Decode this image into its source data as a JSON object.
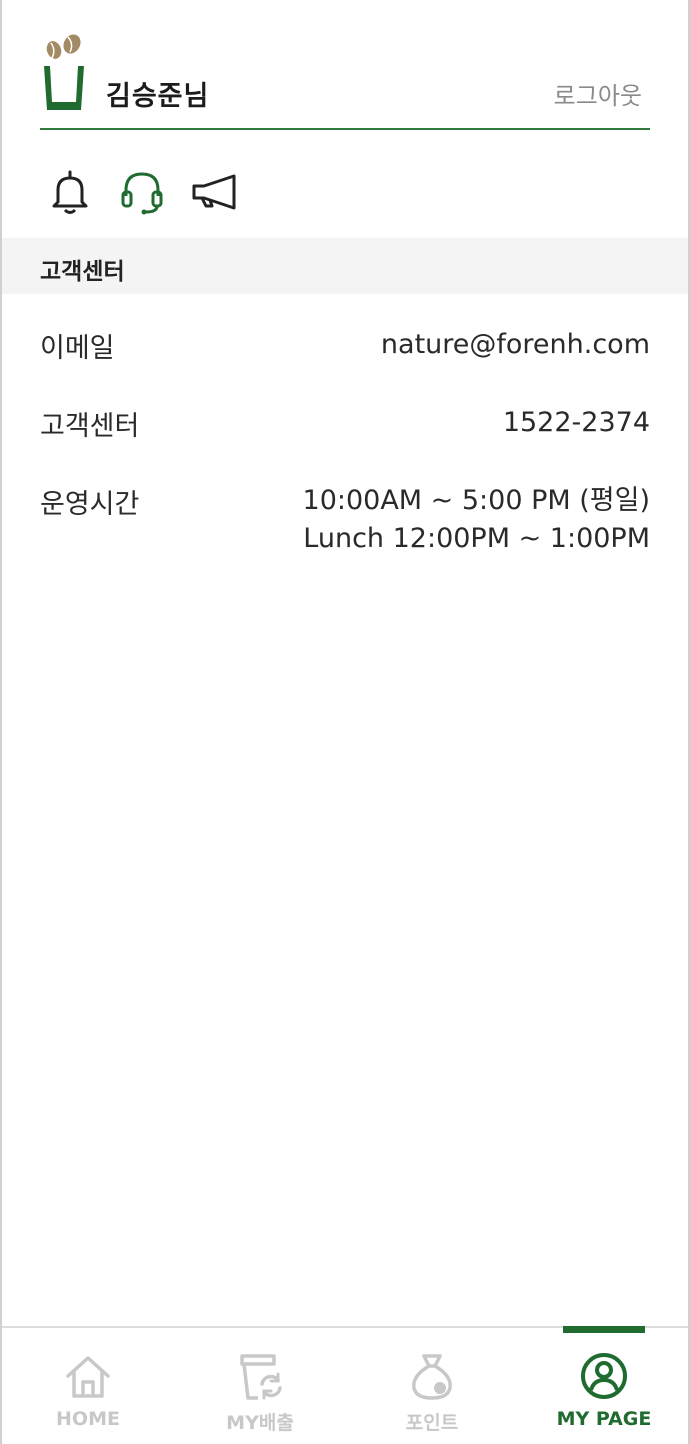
{
  "header": {
    "username": "김승준님",
    "logout_label": "로그아웃"
  },
  "icons": [
    {
      "name": "notification",
      "icon": "bell-icon"
    },
    {
      "name": "customer-center",
      "icon": "headset-icon",
      "active": true
    },
    {
      "name": "notice",
      "icon": "megaphone-icon"
    }
  ],
  "section": {
    "title": "고객센터"
  },
  "info": {
    "email_label": "이메일",
    "email_value": "nature@forenh.com",
    "phone_label": "고객센터",
    "phone_value": "1522-2374",
    "hours_label": "운영시간",
    "hours_value_1": "10:00AM ~ 5:00 PM (평일)",
    "hours_value_2": "Lunch 12:00PM ~ 1:00PM"
  },
  "bottom_nav": {
    "items": [
      {
        "label": "HOME",
        "icon": "home-icon"
      },
      {
        "label": "MY배출",
        "icon": "cup-recycle-icon"
      },
      {
        "label": "포인트",
        "icon": "money-bag-icon"
      },
      {
        "label": "MY PAGE",
        "icon": "user-circle-icon",
        "active": true
      }
    ]
  },
  "colors": {
    "brand_green": "#1f6b30",
    "bean_brown": "#a48a62",
    "muted_gray": "#c8c8c8"
  }
}
